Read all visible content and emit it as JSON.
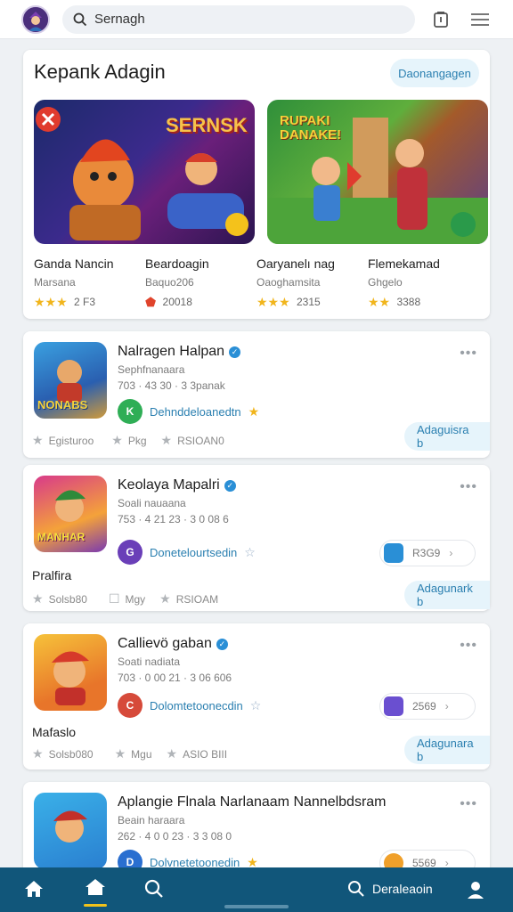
{
  "search": {
    "value": "Sernagh"
  },
  "featured": {
    "title": "Kepaпk Adagin",
    "more_label": "Daonangagen",
    "banner1_text": "SERNSK",
    "banner2_text": "RUPAKI DANAKE!",
    "items": [
      {
        "name": "Ganda Nancin",
        "sub": "Marsana",
        "rating": "2 F3",
        "stars": 3
      },
      {
        "name": "Beardoagin",
        "sub": "Baquo206",
        "rating": "20018",
        "stars": 1
      },
      {
        "name": "Oaryanelı nag",
        "sub": "Oaoghamsita",
        "rating": "2315",
        "stars": 3
      },
      {
        "name": "Flemekamad",
        "sub": "Ghgelo",
        "rating": "3388",
        "stars": 2
      }
    ]
  },
  "apps": [
    {
      "title": "Nalragen Halpan",
      "sub1": "Sephfnanaara",
      "sub2": "703 · 43 30 · 3 3panak",
      "developer": "Dehnddeloanedtn",
      "icon_label": "NONABS",
      "footer": [
        "Egisturoo",
        "Pkg",
        "RSIOAN0"
      ],
      "install_label": "Adaguisra b",
      "extra_label": "",
      "side_chip": ""
    },
    {
      "title": "Keolaya Mapalri",
      "sub1": "Soali nauaana",
      "sub2": "753 · 4 21 23 · 3 0 08 6",
      "developer": "Donetelourtsedin",
      "icon_label": "MANHAR",
      "footer": [
        "Solsb80",
        "Mgy",
        "RSIOAM"
      ],
      "install_label": "Adagunark b",
      "extra_label": "Pralfira",
      "side_chip": "R3G9"
    },
    {
      "title": "Callievö gaban",
      "sub1": "Soati nadiata",
      "sub2": "703 · 0 00 21 · 3 06 606",
      "developer": "Dolomtetoonecdin",
      "icon_label": "",
      "footer": [
        "Solsb080",
        "Mgu",
        "ASIO BIII"
      ],
      "install_label": "Adagunara b",
      "extra_label": "Mafaslo",
      "side_chip": "2569"
    },
    {
      "title": "Aplangie Flnala Narlanaam Nannelbdsram",
      "sub1": "Beain haraara",
      "sub2": "262 · 4 0 0 23 · 3 3 08 0",
      "developer": "Dolvnetetoonedin",
      "icon_label": "",
      "footer": [],
      "install_label": "",
      "extra_label": "",
      "side_chip": "5569"
    }
  ],
  "bottom_nav": {
    "search_label": "Deraleaoin"
  },
  "colors": {
    "accent": "#2a7fb0",
    "nav": "#11567a",
    "star": "#f1b51c"
  }
}
